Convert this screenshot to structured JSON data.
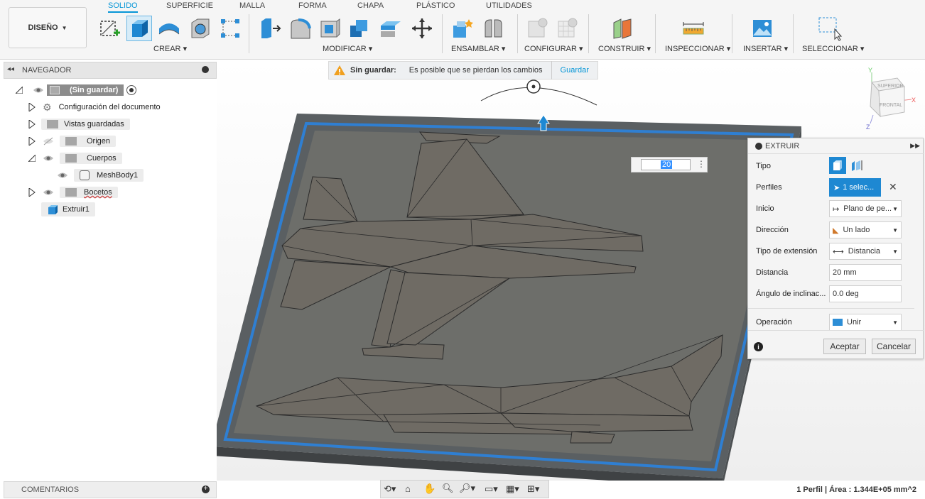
{
  "toolbar": {
    "design_label": "DISEÑO",
    "tabs": [
      "SOLIDO",
      "SUPERFICIE",
      "MALLA",
      "FORMA",
      "CHAPA",
      "PLÁSTICO",
      "UTILIDADES"
    ],
    "groups": [
      "CREAR",
      "MODIFICAR",
      "ENSAMBLAR",
      "CONFIGURAR",
      "CONSTRUIR",
      "INSPECCIONAR",
      "INSERTAR",
      "SELECCIONAR"
    ],
    "accent": "#0696d7"
  },
  "navigator": {
    "title": "NAVEGADOR",
    "root": "(Sin guardar)",
    "items": [
      "Configuración del documento",
      "Vistas guardadas",
      "Origen",
      "Cuerpos",
      "MeshBody1",
      "Bocetos",
      "Extruir1"
    ]
  },
  "warning": {
    "title": "Sin guardar:",
    "message": "Es posible que se pierdan los cambios",
    "action": "Guardar"
  },
  "viewcube": {
    "top": "SUPERIOR",
    "front": "FRONTAL",
    "x": "X",
    "y": "Y",
    "z": "Z"
  },
  "distance_input": {
    "value": "20"
  },
  "extrude": {
    "title": "EXTRUIR",
    "rows": {
      "tipo": "Tipo",
      "perfiles": "Perfiles",
      "perfiles_value": "1 selec...",
      "inicio": "Inicio",
      "inicio_value": "Plano de pe...",
      "direccion": "Dirección",
      "direccion_value": "Un lado",
      "tipo_ext": "Tipo de extensión",
      "tipo_ext_value": "Distancia",
      "distancia": "Distancia",
      "distancia_value": "20 mm",
      "angulo": "Ángulo de inclinac...",
      "angulo_value": "0.0 deg",
      "operacion": "Operación",
      "operacion_value": "Unir"
    },
    "accept": "Aceptar",
    "cancel": "Cancelar"
  },
  "comments": {
    "title": "COMENTARIOS"
  },
  "status": {
    "text": "1 Perfil | Área : 1.344E+05 mm^2"
  }
}
